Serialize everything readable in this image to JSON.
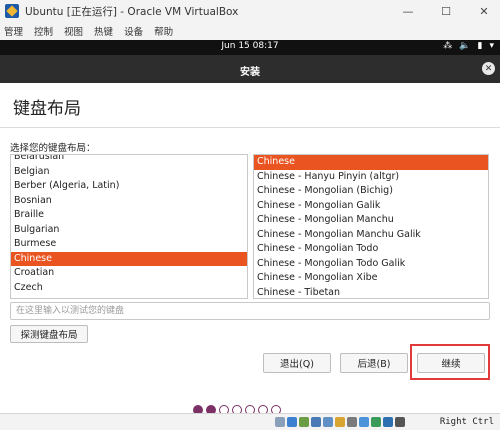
{
  "vbox": {
    "title": "Ubuntu [正在运行] - Oracle VM VirtualBox",
    "menu": [
      "管理",
      "控制",
      "视图",
      "热键",
      "设备",
      "帮助"
    ],
    "window_buttons": [
      "—",
      "☐",
      "✕"
    ],
    "host_key": "Right Ctrl"
  },
  "gnome": {
    "clock": "Jun 15  08:17",
    "tray": [
      "⁂",
      "🔈",
      "▮",
      "▾"
    ]
  },
  "installer": {
    "header_title": "安装",
    "page_title": "键盘布局",
    "choose_label": "选择您的键盘布局：",
    "layouts": [
      "Belarusian",
      "Belgian",
      "Berber (Algeria, Latin)",
      "Bosnian",
      "Braille",
      "Bulgarian",
      "Burmese",
      "Chinese",
      "Croatian",
      "Czech"
    ],
    "selected_layout": "Chinese",
    "variants": [
      "Chinese",
      "Chinese - Hanyu Pinyin (altgr)",
      "Chinese - Mongolian (Bichig)",
      "Chinese - Mongolian Galik",
      "Chinese - Mongolian Manchu",
      "Chinese - Mongolian Manchu Galik",
      "Chinese - Mongolian Todo",
      "Chinese - Mongolian Todo Galik",
      "Chinese - Mongolian Xibe",
      "Chinese - Tibetan"
    ],
    "selected_variant": "Chinese",
    "test_placeholder": "在这里输入以测试您的键盘",
    "detect_button": "探测键盘布局",
    "quit_button": "退出(Q)",
    "back_button": "后退(B)",
    "continue_button": "继续",
    "progress": {
      "completed": 2,
      "total": 7
    }
  },
  "colors": {
    "accent": "#e95420",
    "progress": "#7b3166",
    "highlight": "#e03a3a"
  }
}
